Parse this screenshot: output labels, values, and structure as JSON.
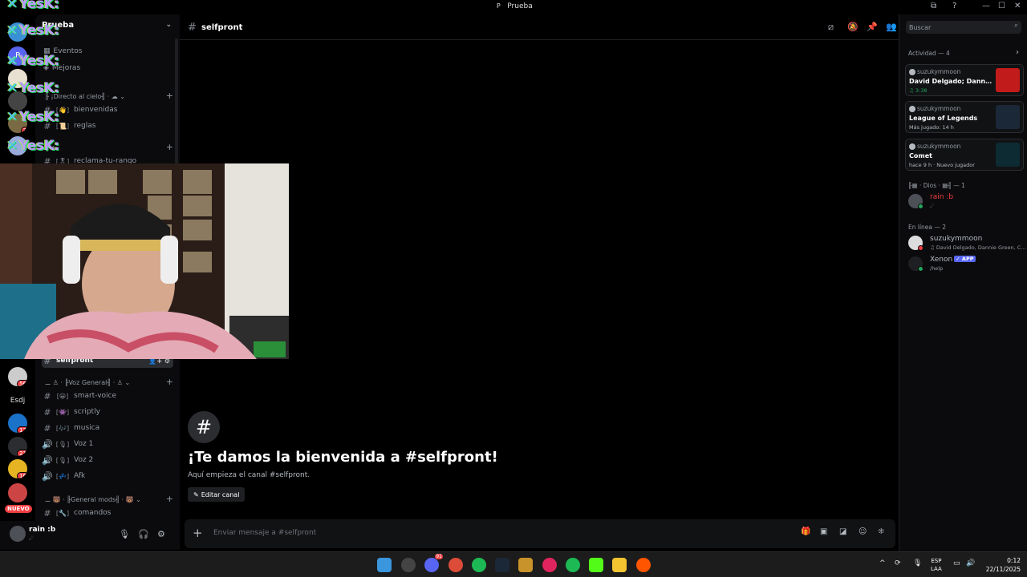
{
  "window": {
    "title": "Prueba",
    "title_badge": "P",
    "controls": {
      "minimize": "—",
      "maximize": "☐",
      "close": "✕"
    }
  },
  "overlay_text": {
    "yesk": "YesK:"
  },
  "server_header": {
    "name": "Prueba"
  },
  "sidebar": {
    "top_items": [
      {
        "label": "Eventos"
      },
      {
        "label": "Mejoras"
      }
    ],
    "categories": [
      {
        "label": "╟ ¡Directo al cielo╢ · ☁ ⌄"
      },
      {
        "label": "╟ ◈ ·"
      },
      {
        "label": "⚊ ♙ · ╟Voz General╢ · ♙ ⌄"
      },
      {
        "label": "⚊ 🐻 · ╟General mods╢ · 🐻 ⌄"
      }
    ],
    "channels_top": [
      {
        "name": "bienvenidas",
        "emoji": "[👋]"
      },
      {
        "name": "reglas",
        "emoji": "[📜]"
      },
      {
        "name": "reclama-tu-rango",
        "emoji": "[🎖]"
      }
    ],
    "active_channel": {
      "name": "selfpront"
    },
    "channels_bottom": [
      {
        "name": "smart-voice",
        "emoji": "[😀]",
        "type": "text"
      },
      {
        "name": "scriptly",
        "emoji": "[👾]",
        "type": "text"
      },
      {
        "name": "musica",
        "emoji": "[🎶]",
        "type": "text"
      },
      {
        "name": "Voz 1",
        "emoji": "[🎙]",
        "type": "voice"
      },
      {
        "name": "Voz 2",
        "emoji": "[🎙]",
        "type": "voice"
      },
      {
        "name": "Afk",
        "emoji": "[💤]",
        "type": "voice"
      },
      {
        "name": "comandos",
        "emoji": "[🔧]",
        "type": "text"
      }
    ]
  },
  "rail": {
    "badges": [
      "3",
      "56",
      "17",
      "21",
      "16"
    ],
    "text_server": "Esdj",
    "new_label": "NUEVO"
  },
  "user_panel": {
    "name": "rain :b",
    "status": "☄"
  },
  "channel_header": {
    "name": "selfpront"
  },
  "welcome": {
    "title": "¡Te damos la bienvenida a #selfpront!",
    "subtitle": "Aquí empieza el canal #selfpront.",
    "edit_label": "Editar canal"
  },
  "composer": {
    "placeholder": "Enviar mensaje a #selfpront"
  },
  "members": {
    "search_placeholder": "Buscar",
    "activity_title": "Actividad — 4",
    "activities": [
      {
        "user": "suzukymmoon",
        "title": "David Delgado; Dannie Gre...",
        "meta": "♫ 3:38",
        "meta_color": "#23a55a",
        "thumb": "#c21b1b"
      },
      {
        "user": "suzukymmoon",
        "title": "League of Legends",
        "meta": "Más jugado: 14 h",
        "meta_color": "#b5bac1",
        "thumb": "#1b2838"
      },
      {
        "user": "suzukymmoon",
        "title": "Comet",
        "meta": "hace 9 h · Nuevo jugador",
        "meta_color": "#b5bac1",
        "thumb": "#0d2b33"
      }
    ],
    "role_sections": [
      {
        "title": "╟▦ · Dios · ▦╢ — 1"
      },
      {
        "title": "En línea — 2"
      }
    ],
    "role_members": [
      {
        "name": "rain :b",
        "sub": "☄",
        "name_color": "#f23f43"
      }
    ],
    "online_members": [
      {
        "name": "suzukymmoon",
        "sub": "♫ David Delgado, Dannie Green, C...",
        "name_color": "#b5bac1"
      },
      {
        "name": "Xenon",
        "sub": "/help",
        "name_color": "#b5bac1",
        "tag": "✓ APP"
      }
    ]
  },
  "taskbar": {
    "lang_top": "ESP",
    "lang_bottom": "LAA",
    "time": "0:12",
    "date": "22/11/2025",
    "discord_badge": "91"
  }
}
